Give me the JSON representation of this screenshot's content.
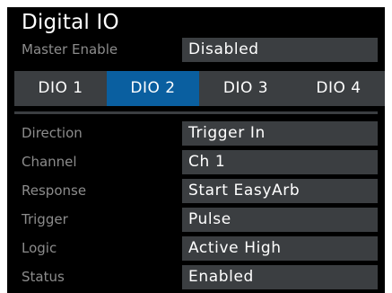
{
  "title": "Digital IO",
  "master_enable": {
    "label": "Master Enable",
    "value": "Disabled"
  },
  "tabs": [
    {
      "label": "DIO 1",
      "active": false
    },
    {
      "label": "DIO 2",
      "active": true
    },
    {
      "label": "DIO 3",
      "active": false
    },
    {
      "label": "DIO 4",
      "active": false
    }
  ],
  "settings": [
    {
      "label": "Direction",
      "value": "Trigger In"
    },
    {
      "label": "Channel",
      "value": "Ch 1"
    },
    {
      "label": "Response",
      "value": "Start EasyArb"
    },
    {
      "label": "Trigger",
      "value": "Pulse"
    },
    {
      "label": "Logic",
      "value": "Active High"
    },
    {
      "label": "Status",
      "value": "Enabled"
    }
  ],
  "colors": {
    "background": "#000000",
    "field": "#3b3e41",
    "active_tab": "#0a5fa0",
    "label_text": "#8c8c8c",
    "value_text": "#ffffff"
  }
}
